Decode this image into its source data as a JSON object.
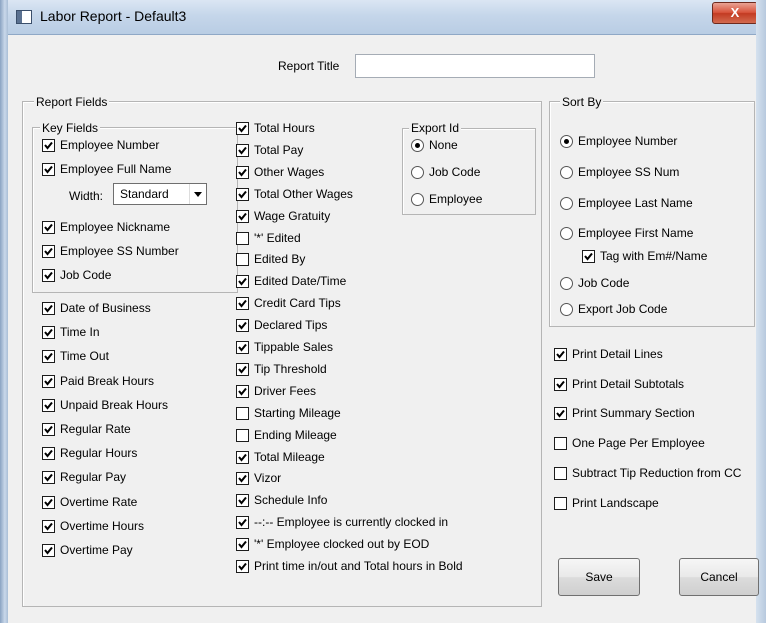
{
  "window": {
    "title": "Labor Report  - Default3",
    "close_glyph": "X"
  },
  "report_title": {
    "label": "Report Title",
    "value": ""
  },
  "report_fields": {
    "label": "Report Fields",
    "key_fields": {
      "label": "Key Fields",
      "items": [
        {
          "label": "Employee Number",
          "checked": true
        },
        {
          "label": "Employee Full Name",
          "checked": true
        },
        {
          "label": "Employee Nickname",
          "checked": true
        },
        {
          "label": "Employee SS Number",
          "checked": true
        },
        {
          "label": "Job Code",
          "checked": true
        }
      ],
      "width_label": "Width:",
      "width_value": "Standard"
    },
    "left_items": [
      {
        "label": "Date of Business",
        "checked": true
      },
      {
        "label": "Time In",
        "checked": true
      },
      {
        "label": "Time Out",
        "checked": true
      },
      {
        "label": "Paid Break Hours",
        "checked": true
      },
      {
        "label": "Unpaid Break Hours",
        "checked": true
      },
      {
        "label": "Regular Rate",
        "checked": true
      },
      {
        "label": "Regular Hours",
        "checked": true
      },
      {
        "label": "Regular Pay",
        "checked": true
      },
      {
        "label": "Overtime Rate",
        "checked": true
      },
      {
        "label": "Overtime Hours",
        "checked": true
      },
      {
        "label": "Overtime Pay",
        "checked": true
      }
    ],
    "middle_items": [
      {
        "label": "Total Hours",
        "checked": true
      },
      {
        "label": "Total Pay",
        "checked": true
      },
      {
        "label": "Other Wages",
        "checked": true
      },
      {
        "label": "Total Other Wages",
        "checked": true
      },
      {
        "label": "Wage Gratuity",
        "checked": true
      },
      {
        "label": "'*' Edited",
        "checked": false
      },
      {
        "label": "Edited By",
        "checked": false
      },
      {
        "label": "Edited Date/Time",
        "checked": true
      },
      {
        "label": "Credit Card Tips",
        "checked": true
      },
      {
        "label": "Declared Tips",
        "checked": true
      },
      {
        "label": "Tippable Sales",
        "checked": true
      },
      {
        "label": "Tip Threshold",
        "checked": true
      },
      {
        "label": "Driver Fees",
        "checked": true
      },
      {
        "label": "Starting Mileage",
        "checked": false
      },
      {
        "label": "Ending Mileage",
        "checked": false
      },
      {
        "label": "Total Mileage",
        "checked": true
      },
      {
        "label": "Vizor",
        "checked": true
      },
      {
        "label": "Schedule Info",
        "checked": true
      },
      {
        "label": "--:-- Employee is currently clocked in",
        "checked": true
      },
      {
        "label": "'*' Employee clocked out by EOD",
        "checked": true
      },
      {
        "label": "Print time in/out and Total hours in Bold",
        "checked": true
      }
    ],
    "export_id": {
      "label": "Export Id",
      "options": [
        "None",
        "Job Code",
        "Employee"
      ],
      "selected": "None"
    }
  },
  "sort_by": {
    "label": "Sort By",
    "options": [
      "Employee Number",
      "Employee SS Num",
      "Employee Last Name",
      "Employee First Name",
      "Job Code",
      "Export Job Code"
    ],
    "selected": "Employee Number",
    "tag_option": {
      "label": "Tag with Em#/Name",
      "checked": true
    }
  },
  "print_options": [
    {
      "label": "Print Detail Lines",
      "checked": true
    },
    {
      "label": "Print Detail Subtotals",
      "checked": true
    },
    {
      "label": "Print Summary Section",
      "checked": true
    },
    {
      "label": "One Page Per Employee",
      "checked": false
    },
    {
      "label": "Subtract Tip Reduction from CC",
      "checked": false
    },
    {
      "label": "Print Landscape",
      "checked": false
    }
  ],
  "buttons": {
    "save": "Save",
    "cancel": "Cancel"
  }
}
